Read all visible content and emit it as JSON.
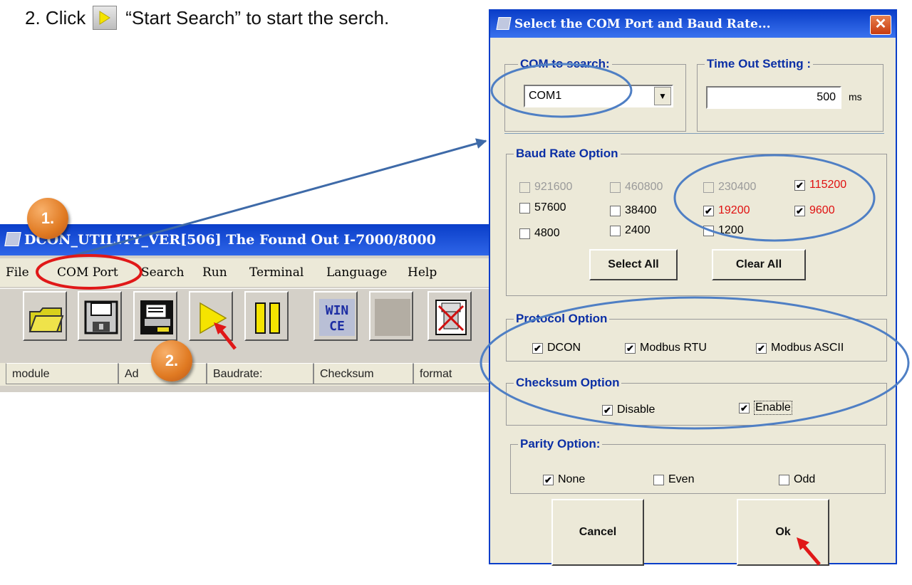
{
  "instruction": {
    "number": "2.",
    "click_word": "Click",
    "quoted": "“Start Search” to start the serch."
  },
  "dcon": {
    "title": "DCON_UTILITY_VER[506] The Found Out I-7000/8000",
    "menu": [
      "File",
      "COM Port",
      "Search",
      "Run",
      "Terminal",
      "Language",
      "Help"
    ],
    "toolbar_icons": [
      "open-folder-icon",
      "save-disk-icon",
      "printer-icon",
      "play-search-icon",
      "pause-icon",
      "wince-icon",
      "blank-icon",
      "disconnect-icon"
    ],
    "wince_text": [
      "WIN",
      "CE"
    ],
    "status": [
      "module",
      "Ad",
      "Baudrate:",
      "Checksum",
      "format"
    ]
  },
  "badges": {
    "step1": "1.",
    "step2": "2."
  },
  "dialog": {
    "title": "Select the COM Port and Baud Rate...",
    "close": "✕",
    "com_group": {
      "legend": "COM to search:",
      "value": "COM1"
    },
    "timeout_group": {
      "legend": "Time Out Setting :",
      "value": "500",
      "unit": "ms"
    },
    "baud_group": {
      "legend": "Baud Rate Option",
      "options": [
        {
          "label": "921600",
          "checked": false,
          "disabled": true,
          "red": false
        },
        {
          "label": "460800",
          "checked": false,
          "disabled": true,
          "red": false
        },
        {
          "label": "230400",
          "checked": false,
          "disabled": true,
          "red": false
        },
        {
          "label": "115200",
          "checked": true,
          "disabled": false,
          "red": true
        },
        {
          "label": "57600",
          "checked": false,
          "disabled": false,
          "red": false
        },
        {
          "label": "38400",
          "checked": false,
          "disabled": false,
          "red": false
        },
        {
          "label": "19200",
          "checked": true,
          "disabled": false,
          "red": true
        },
        {
          "label": "9600",
          "checked": true,
          "disabled": false,
          "red": true
        },
        {
          "label": "4800",
          "checked": false,
          "disabled": false,
          "red": false
        },
        {
          "label": "2400",
          "checked": false,
          "disabled": false,
          "red": false
        },
        {
          "label": "1200",
          "checked": false,
          "disabled": false,
          "red": false
        }
      ],
      "select_all": "Select All",
      "clear_all": "Clear All"
    },
    "protocol_group": {
      "legend": "Protocol Option",
      "options": [
        {
          "label": "DCON",
          "checked": true
        },
        {
          "label": "Modbus RTU",
          "checked": true
        },
        {
          "label": "Modbus ASCII",
          "checked": true
        }
      ]
    },
    "checksum_group": {
      "legend": "Checksum  Option",
      "options": [
        {
          "label": "Disable",
          "checked": true
        },
        {
          "label": "Enable",
          "checked": true
        }
      ]
    },
    "parity_group": {
      "legend": "Parity Option:",
      "options": [
        {
          "label": "None",
          "checked": true
        },
        {
          "label": "Even",
          "checked": false
        },
        {
          "label": "Odd",
          "checked": false
        }
      ]
    },
    "cancel": "Cancel",
    "ok": "Ok"
  },
  "colors": {
    "annotation_blue": "#4f7fc4",
    "annotation_red": "#e01818",
    "badge_orange": "#e07a22",
    "title_blue": "#0a3ec9",
    "legend_blue": "#0b2fa5"
  }
}
